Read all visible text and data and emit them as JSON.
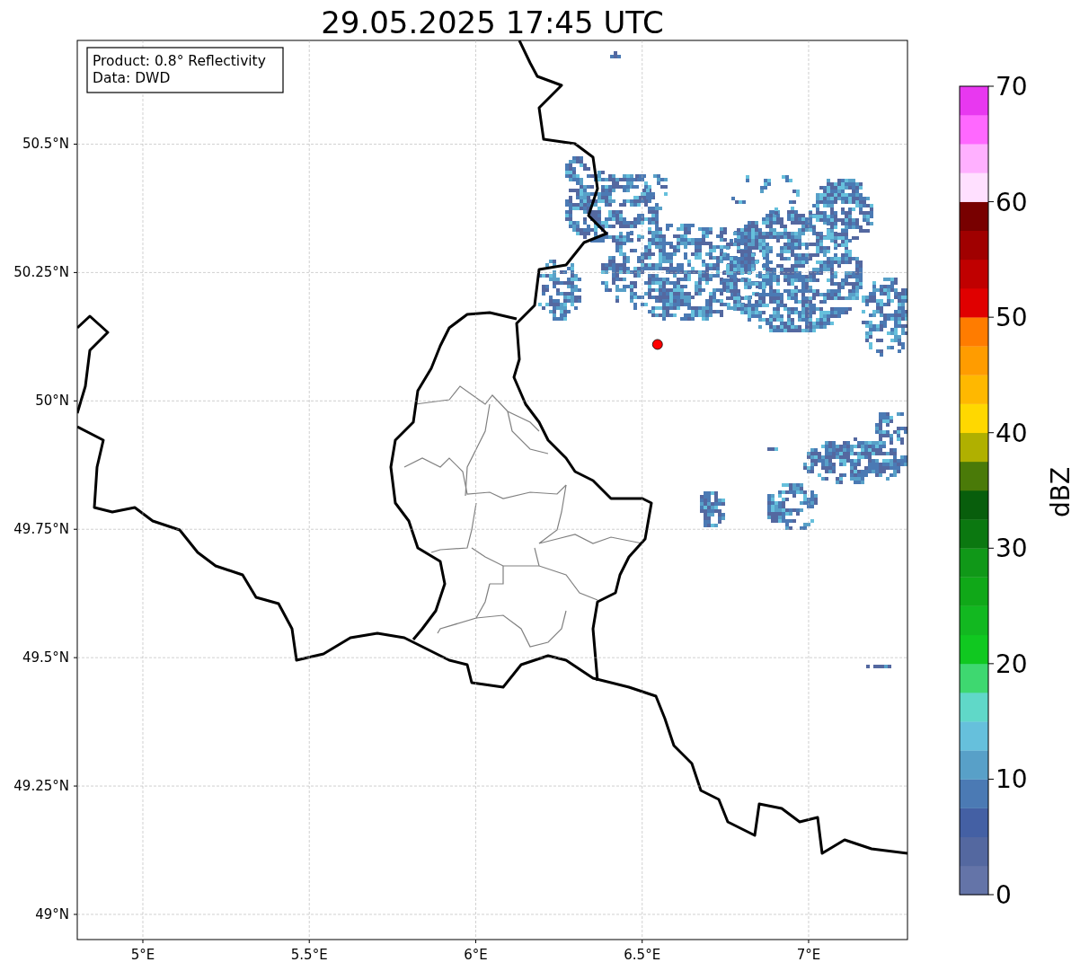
{
  "map": {
    "info_box": [
      "Product: 0.8° Reflectivity",
      "Data: DWD"
    ],
    "chart_data": {
      "type": "scatter",
      "title": "29.05.2025 17:45 UTC",
      "xlim": [
        4.803,
        7.297
      ],
      "ylim": [
        48.951,
        50.702
      ],
      "xticks": [
        {
          "value": 5,
          "label": "5°E"
        },
        {
          "value": 5.5,
          "label": "5.5°E"
        },
        {
          "value": 6,
          "label": "6°E"
        },
        {
          "value": 6.5,
          "label": "6.5°E"
        },
        {
          "value": 7,
          "label": "7°E"
        }
      ],
      "yticks": [
        {
          "value": 49,
          "label": "49°N"
        },
        {
          "value": 49.25,
          "label": "49.25°N"
        },
        {
          "value": 49.5,
          "label": "49.5°N"
        },
        {
          "value": 49.75,
          "label": "49.75°N"
        },
        {
          "value": 50,
          "label": "50°N"
        },
        {
          "value": 50.25,
          "label": "50.25°N"
        },
        {
          "value": 50.5,
          "label": "50.5°N"
        }
      ],
      "grid": true,
      "x": [
        6.546
      ],
      "series": [
        {
          "color": "#ff0000",
          "values": [
            50.11
          ]
        }
      ]
    }
  },
  "colorbar": {
    "label": "dBZ",
    "ticks": [
      "70",
      "60",
      "50",
      "40",
      "30",
      "20",
      "10",
      "0"
    ],
    "segments": [
      {
        "color": "#6474a8"
      },
      {
        "color": "#5468a0"
      },
      {
        "color": "#4460a4"
      },
      {
        "color": "#4b7ab4"
      },
      {
        "color": "#58a0c8"
      },
      {
        "color": "#66c0dc"
      },
      {
        "color": "#60d8c8"
      },
      {
        "color": "#3ed870"
      },
      {
        "color": "#10c820"
      },
      {
        "color": "#12b820"
      },
      {
        "color": "#10a818"
      },
      {
        "color": "#109818"
      },
      {
        "color": "#0b7810"
      },
      {
        "color": "#085e0c"
      },
      {
        "color": "#4a7a08"
      },
      {
        "color": "#b0b000"
      },
      {
        "color": "#ffd800"
      },
      {
        "color": "#ffb800"
      },
      {
        "color": "#ff9c00"
      },
      {
        "color": "#ff7c00"
      },
      {
        "color": "#e00000"
      },
      {
        "color": "#c00000"
      },
      {
        "color": "#a00000"
      },
      {
        "color": "#780000"
      },
      {
        "color": "#ffe0ff"
      },
      {
        "color": "#ffb0ff"
      },
      {
        "color": "#ff68ff"
      },
      {
        "color": "#e838f0"
      }
    ]
  }
}
